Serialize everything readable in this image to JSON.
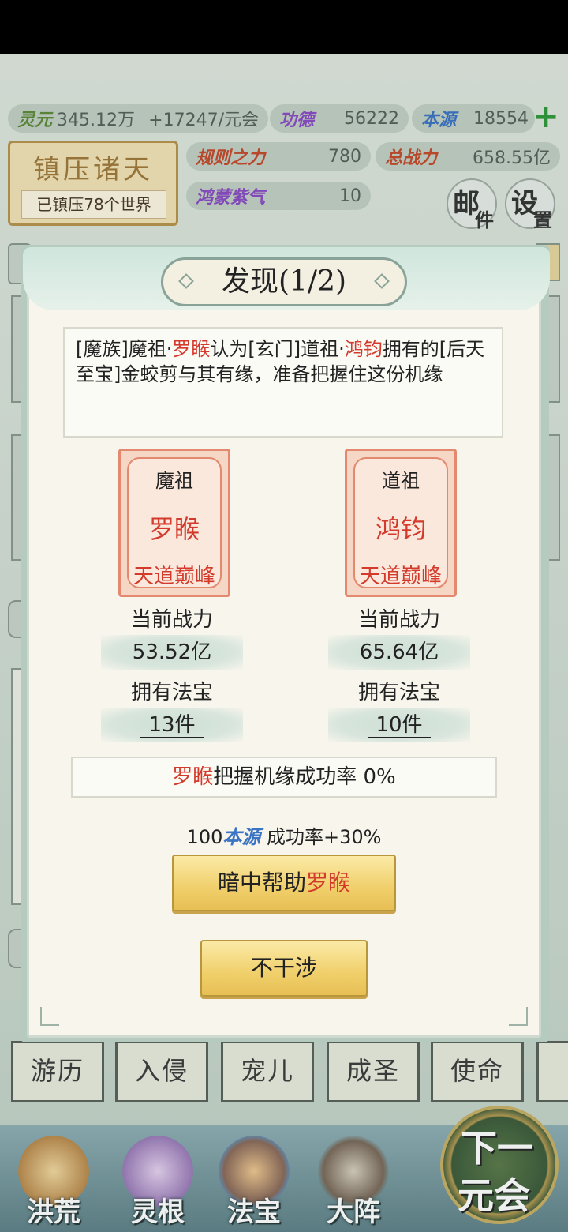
{
  "resources": {
    "lingyuan": {
      "label": "灵元",
      "value": "345.12万",
      "rate": "+17247/元会"
    },
    "gongde": {
      "label": "功德",
      "value": "56222"
    },
    "benyuan": {
      "label": "本源",
      "value": "18554"
    },
    "guize": {
      "label": "规则之力",
      "value": "780"
    },
    "zongzhanli": {
      "label": "总战力",
      "value": "658.55亿"
    },
    "hongmeng": {
      "label": "鸿蒙紫气",
      "value": "10"
    },
    "plus_icon": "plus-icon"
  },
  "realm": {
    "title": "镇压诸天",
    "subtitle": "已镇压78个世界"
  },
  "round_buttons": {
    "mail": {
      "big": "邮",
      "small": "件"
    },
    "settings": {
      "big": "设",
      "small": "置"
    }
  },
  "bottom_tabs": [
    "游历",
    "入侵",
    "宠儿",
    "成圣",
    "使命"
  ],
  "bottom_nav": [
    {
      "label": "洪荒",
      "icon": "mountain-icon"
    },
    {
      "label": "灵根",
      "icon": "lotus-icon"
    },
    {
      "label": "法宝",
      "icon": "treasure-icon"
    },
    {
      "label": "大阵",
      "icon": "formation-icon"
    }
  ],
  "next_button": {
    "line1": "下一",
    "line2": "元会"
  },
  "modal": {
    "title": "发现(1/2)",
    "description": {
      "p1": "[魔族]魔祖·",
      "name1": "罗睺",
      "p2": "认为[玄门]道祖·",
      "name2": "鸿钧",
      "p3": "拥有的[后天至宝]金蛟剪与其有缘，准备把握住这份机缘"
    },
    "left": {
      "rank": "魔祖",
      "name": "罗睺",
      "level": "天道巅峰",
      "power_label": "当前战力",
      "power": "53.52亿",
      "treasure_label": "拥有法宝",
      "treasure": "13件"
    },
    "right": {
      "rank": "道祖",
      "name": "鸿钧",
      "level": "天道巅峰",
      "power_label": "当前战力",
      "power": "65.64亿",
      "treasure_label": "拥有法宝",
      "treasure": "10件"
    },
    "success_rate": {
      "name": "罗睺",
      "text": "把握机缘成功率 0%"
    },
    "cost": {
      "amount": "100",
      "resource": "本源",
      "effect": " 成功率+30%"
    },
    "help_button": {
      "prefix": "暗中帮助",
      "name": "罗睺"
    },
    "ignore_button": "不干涉"
  },
  "colors": {
    "accent_red": "#d33a2c",
    "gold": "#f0cf6a",
    "benyuan_blue": "#3b74c4"
  }
}
